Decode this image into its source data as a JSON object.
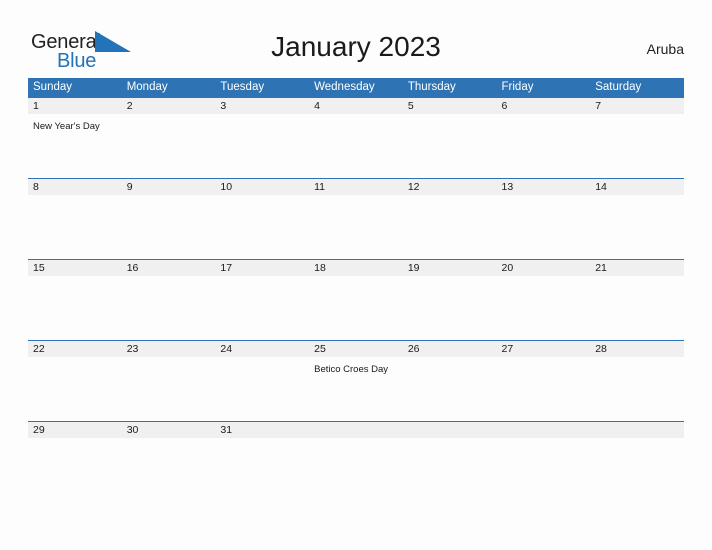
{
  "brand": {
    "line1": "General",
    "line2": "Blue",
    "flag_icon": "blue-triangle-flag-icon",
    "line1_color": "#231f20",
    "line2_color": "#2273b8",
    "flag_color": "#2273b8"
  },
  "header": {
    "title": "January 2023",
    "region": "Aruba"
  },
  "colors": {
    "header_blue": "#2e74b5",
    "row_band_gray": "#f0f0f0",
    "page_background": "#fdfdfd",
    "text_dark": "#1a1a1a"
  },
  "calendar": {
    "weekdays": [
      "Sunday",
      "Monday",
      "Tuesday",
      "Wednesday",
      "Thursday",
      "Friday",
      "Saturday"
    ],
    "weeks": [
      {
        "days": [
          {
            "num": "1",
            "event": "New Year's Day"
          },
          {
            "num": "2",
            "event": ""
          },
          {
            "num": "3",
            "event": ""
          },
          {
            "num": "4",
            "event": ""
          },
          {
            "num": "5",
            "event": ""
          },
          {
            "num": "6",
            "event": ""
          },
          {
            "num": "7",
            "event": ""
          }
        ]
      },
      {
        "days": [
          {
            "num": "8",
            "event": ""
          },
          {
            "num": "9",
            "event": ""
          },
          {
            "num": "10",
            "event": ""
          },
          {
            "num": "11",
            "event": ""
          },
          {
            "num": "12",
            "event": ""
          },
          {
            "num": "13",
            "event": ""
          },
          {
            "num": "14",
            "event": ""
          }
        ]
      },
      {
        "days": [
          {
            "num": "15",
            "event": ""
          },
          {
            "num": "16",
            "event": ""
          },
          {
            "num": "17",
            "event": ""
          },
          {
            "num": "18",
            "event": ""
          },
          {
            "num": "19",
            "event": ""
          },
          {
            "num": "20",
            "event": ""
          },
          {
            "num": "21",
            "event": ""
          }
        ]
      },
      {
        "days": [
          {
            "num": "22",
            "event": ""
          },
          {
            "num": "23",
            "event": ""
          },
          {
            "num": "24",
            "event": ""
          },
          {
            "num": "25",
            "event": "Betico Croes Day"
          },
          {
            "num": "26",
            "event": ""
          },
          {
            "num": "27",
            "event": ""
          },
          {
            "num": "28",
            "event": ""
          }
        ]
      },
      {
        "days": [
          {
            "num": "29",
            "event": ""
          },
          {
            "num": "30",
            "event": ""
          },
          {
            "num": "31",
            "event": ""
          },
          {
            "num": "",
            "event": ""
          },
          {
            "num": "",
            "event": ""
          },
          {
            "num": "",
            "event": ""
          },
          {
            "num": "",
            "event": ""
          }
        ]
      }
    ]
  }
}
